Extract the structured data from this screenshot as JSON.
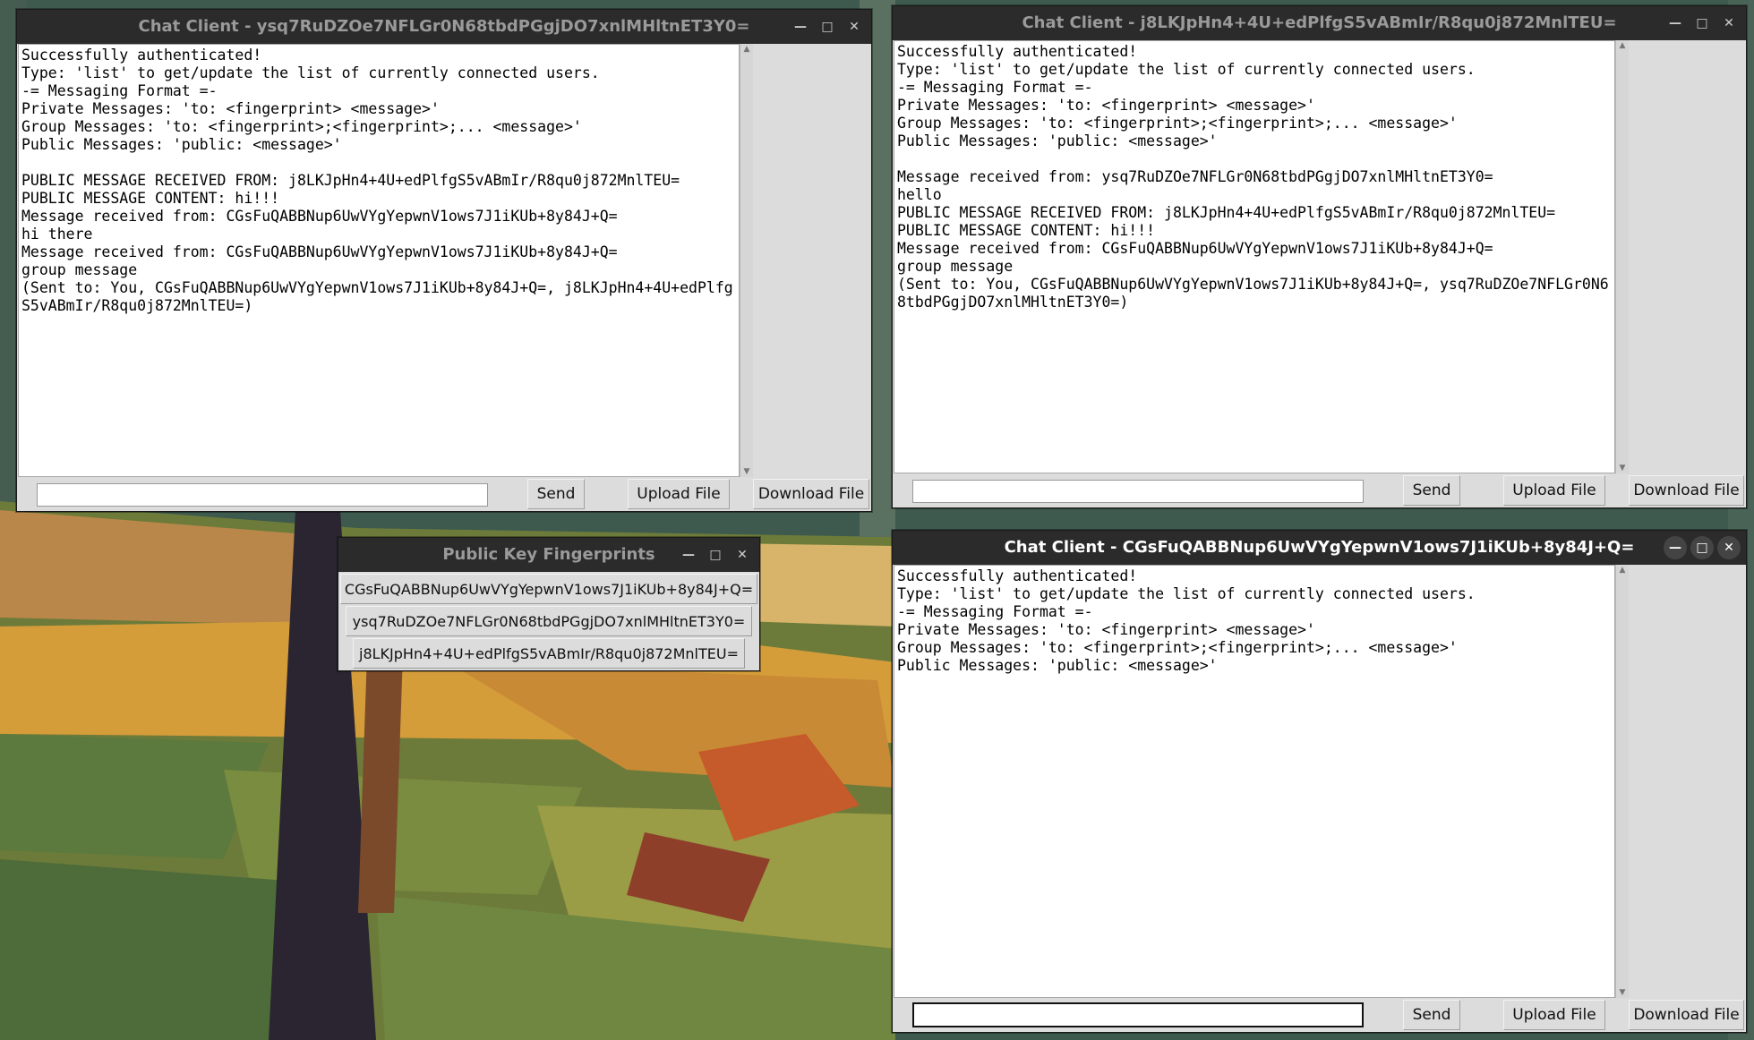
{
  "colors": {
    "titlebar": "#2b2b2b",
    "window_bg": "#dcdcdc",
    "log_bg": "#ffffff"
  },
  "window1": {
    "title": "Chat Client - ysq7RuDZOe7NFLGr0N68tbdPGgjDO7xnlMHltnET3Y0=",
    "lines": [
      "Successfully authenticated!",
      "Type: 'list' to get/update the list of currently connected users.",
      "-= Messaging Format =-",
      "Private Messages: 'to: <fingerprint> <message>'",
      "Group Messages: 'to: <fingerprint>;<fingerprint>;... <message>'",
      "Public Messages: 'public: <message>'",
      "",
      "PUBLIC MESSAGE RECEIVED FROM: j8LKJpHn4+4U+edPlfgS5vABmIr/R8qu0j872MnlTEU=",
      "PUBLIC MESSAGE CONTENT: hi!!!",
      "Message received from: CGsFuQABBNup6UwVYgYepwnV1ows7J1iKUb+8y84J+Q=",
      "hi there",
      "Message received from: CGsFuQABBNup6UwVYgYepwnV1ows7J1iKUb+8y84J+Q=",
      "group message",
      "(Sent to: You, CGsFuQABBNup6UwVYgYepwnV1ows7J1iKUb+8y84J+Q=, j8LKJpHn4+4U+edPlfg",
      "S5vABmIr/R8qu0j872MnlTEU=)"
    ],
    "input_value": "",
    "send_label": "Send",
    "upload_label": "Upload File",
    "download_label": "Download File"
  },
  "window2": {
    "title": "Chat Client - j8LKJpHn4+4U+edPlfgS5vABmIr/R8qu0j872MnlTEU=",
    "lines": [
      "Successfully authenticated!",
      "Type: 'list' to get/update the list of currently connected users.",
      "-= Messaging Format =-",
      "Private Messages: 'to: <fingerprint> <message>'",
      "Group Messages: 'to: <fingerprint>;<fingerprint>;... <message>'",
      "Public Messages: 'public: <message>'",
      "",
      "Message received from: ysq7RuDZOe7NFLGr0N68tbdPGgjDO7xnlMHltnET3Y0=",
      "hello",
      "PUBLIC MESSAGE RECEIVED FROM: j8LKJpHn4+4U+edPlfgS5vABmIr/R8qu0j872MnlTEU=",
      "PUBLIC MESSAGE CONTENT: hi!!!",
      "Message received from: CGsFuQABBNup6UwVYgYepwnV1ows7J1iKUb+8y84J+Q=",
      "group message",
      "(Sent to: You, CGsFuQABBNup6UwVYgYepwnV1ows7J1iKUb+8y84J+Q=, ysq7RuDZOe7NFLGr0N6",
      "8tbdPGgjDO7xnlMHltnET3Y0=)"
    ],
    "input_value": "",
    "send_label": "Send",
    "upload_label": "Upload File",
    "download_label": "Download File"
  },
  "window3": {
    "title": "Chat Client - CGsFuQABBNup6UwVYgYepwnV1ows7J1iKUb+8y84J+Q=",
    "lines": [
      "Successfully authenticated!",
      "Type: 'list' to get/update the list of currently connected users.",
      "-= Messaging Format =-",
      "Private Messages: 'to: <fingerprint> <message>'",
      "Group Messages: 'to: <fingerprint>;<fingerprint>;... <message>'",
      "Public Messages: 'public: <message>'"
    ],
    "input_value": "",
    "send_label": "Send",
    "upload_label": "Upload File",
    "download_label": "Download File"
  },
  "fingerprints": {
    "title": "Public Key Fingerprints",
    "items": [
      "CGsFuQABBNup6UwVYgYepwnV1ows7J1iKUb+8y84J+Q=",
      "ysq7RuDZOe7NFLGr0N68tbdPGgjDO7xnlMHltnET3Y0=",
      "j8LKJpHn4+4U+edPlfgS5vABmIr/R8qu0j872MnlTEU="
    ]
  },
  "icons": {
    "minimize": "minimize-icon",
    "maximize": "maximize-icon",
    "close": "close-icon"
  }
}
